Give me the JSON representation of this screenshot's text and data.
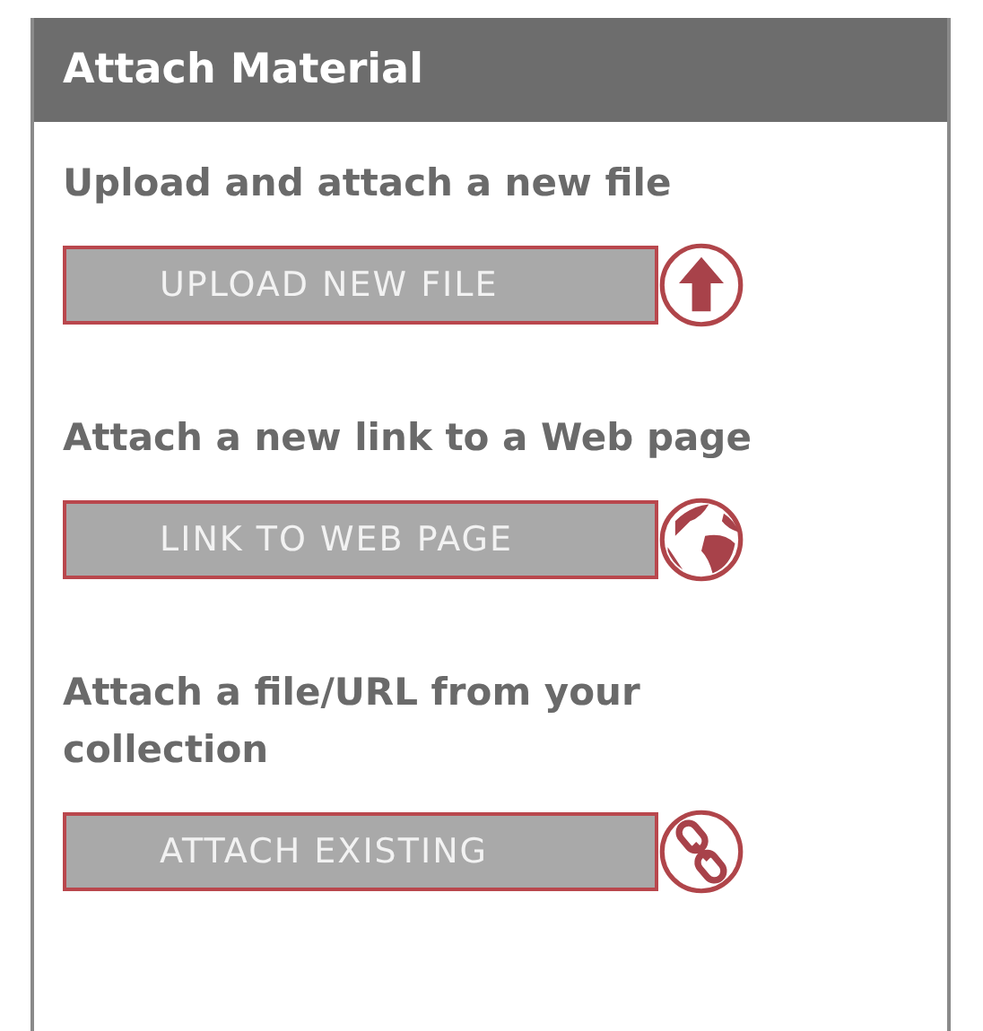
{
  "panel": {
    "title": "Attach Material"
  },
  "sections": [
    {
      "heading": "Upload and attach a new file",
      "button": "UPLOAD NEW FILE",
      "kind": "upload"
    },
    {
      "heading": "Attach a new link to a Web page",
      "button": "LINK TO WEB PAGE",
      "kind": "web"
    },
    {
      "heading": "Attach a file/URL from your collection",
      "button": "ATTACH EXISTING",
      "kind": "existing"
    }
  ]
}
